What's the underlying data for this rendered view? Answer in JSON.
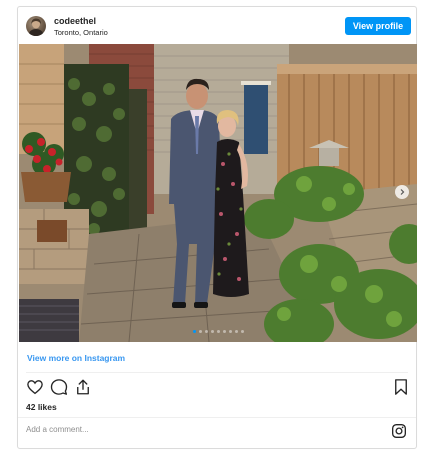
{
  "header": {
    "username": "codeethel",
    "location": "Toronto, Ontario",
    "view_profile_label": "View profile"
  },
  "post": {
    "carousel": {
      "slide_count": 9,
      "active_slide": 1
    },
    "view_more_label": "View more on Instagram",
    "likes_text": "42 likes",
    "comment_placeholder": "Add a comment..."
  },
  "icons": {
    "like": "heart-icon",
    "comment": "comment-icon",
    "share": "share-icon",
    "save": "bookmark-icon",
    "brand": "instagram-icon",
    "next": "chevron-right-icon"
  },
  "colors": {
    "accent": "#0095f6",
    "link": "#3897f0",
    "text": "#262626",
    "muted": "#8e8e8e",
    "border": "#dbdbdb"
  }
}
